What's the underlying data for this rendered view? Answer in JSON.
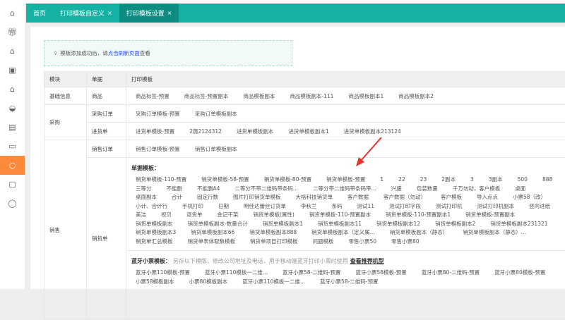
{
  "tabs": [
    {
      "label": "首页"
    },
    {
      "label": "打印模板自定义",
      "close": "×"
    },
    {
      "label": "打印模板设置",
      "close": "×"
    }
  ],
  "tip": {
    "prefix": "模板添加成功后，请",
    "link": "点击刷新页面",
    "suffix": "查看"
  },
  "table": {
    "headers": [
      "模块",
      "单据",
      "打印模板"
    ],
    "rows": {
      "goods": {
        "module": "基础信息",
        "doc": "商品",
        "templates": [
          "商品标签-预置",
          "商品标签-预置副本",
          "商品模板副本",
          "商品模板副本-111",
          "商品模板副本1",
          "商品模板副本2"
        ]
      },
      "purchase_order": {
        "module": "采购",
        "doc": "采购订单",
        "templates": [
          "采购订单模板-预置",
          "采购订单模板副本"
        ]
      },
      "receipt": {
        "doc": "进货单",
        "templates": [
          "进货单模板-预置",
          "2薇2124312",
          "进货单模板副本",
          "进货单模板副本1",
          "进货单模板副本213124"
        ]
      },
      "sales_order": {
        "module": "销售",
        "doc": "销售订单",
        "templates": [
          "销售订单模板-预置",
          "销售订单模板副本"
        ]
      },
      "sales_slip": {
        "doc": "销货单",
        "doc_title": "单据模板：",
        "lines": [
          [
            "销货单模板-110-预置",
            "销货单模板-58-预置",
            "销货单模板-80-预置",
            "销货单模板-预置",
            "1",
            "22",
            "23",
            "2副本",
            "3",
            "3副本",
            "500",
            "888"
          ],
          [
            "三等分",
            "不能删",
            "不能删A4",
            "二等分不带二维码带条码...",
            "二等分带二维码带条码带...",
            "兴盛",
            "包装数量",
            "千万勿动，客户模板",
            "桌面"
          ],
          [
            "桌面副本",
            "合计",
            "固定行数",
            "图片打印销货单模板",
            "大格科技销货单",
            "客户数据",
            "客户数据（勿动）",
            "客户模板",
            "导入点点",
            "小票58（改）"
          ],
          [
            "小计、合计行",
            "手机打印",
            "日期",
            "明佳达蕾丝订货单",
            "李秋兰",
            "条码",
            "测试11",
            "测试打印字段",
            "测试打印机",
            "测试打印机副本",
            "竖向进纸"
          ],
          [
            "美洁",
            "视贝",
            "退货单",
            "金记干菜",
            "销货单模板(属性)",
            "销货单模板-110-预置副本",
            "销货单模板-110-预置副本1",
            "销货单模板-预置副本"
          ],
          [
            "销货单模板副本",
            "销货单模板副本-数量合计",
            "销货单模板副本1",
            "销货单模板副本11",
            "销货单模板副本12",
            "销货单模板副本2",
            "销货单模板副本231321"
          ],
          [
            "销货单模板副本3",
            "销货单模板副本66",
            "销货单模板副本888",
            "销货单模板副本（定义属...",
            "销货单模板副本（静态）",
            "销货单模板副本（静态）..."
          ],
          [
            "销货单汇总模板",
            "销货单表体取数模板",
            "销货单项目打印模板",
            "问题模板",
            "零售小票50",
            "零售小票80"
          ]
        ],
        "bt_title": "蓝牙小票模板：",
        "bt_note": "另存以下模版，修改公司地址及电话，用于移动端蓝牙打印小票时使用",
        "bt_link": "查看推荐机型",
        "bt_lines": [
          [
            "蓝牙小票110模板-预置",
            "蓝牙小票110模板一二维...",
            "蓝牙小票58-二维码-预置",
            "蓝牙小票58模板-预置",
            "蓝牙小票80-二维码-预置",
            "蓝牙小票80模板-预置"
          ],
          [
            "小票58模板副本",
            "小票80模板副本",
            "蓝牙小票110模板一二维...",
            "蓝牙小票58-二维码-预置"
          ]
        ]
      }
    }
  },
  "colors": {
    "tabs": "#15b2a4",
    "active_tab": "#0e8c81",
    "sidebar_active": "#fb8a3c",
    "arrow": "#e8322a"
  }
}
